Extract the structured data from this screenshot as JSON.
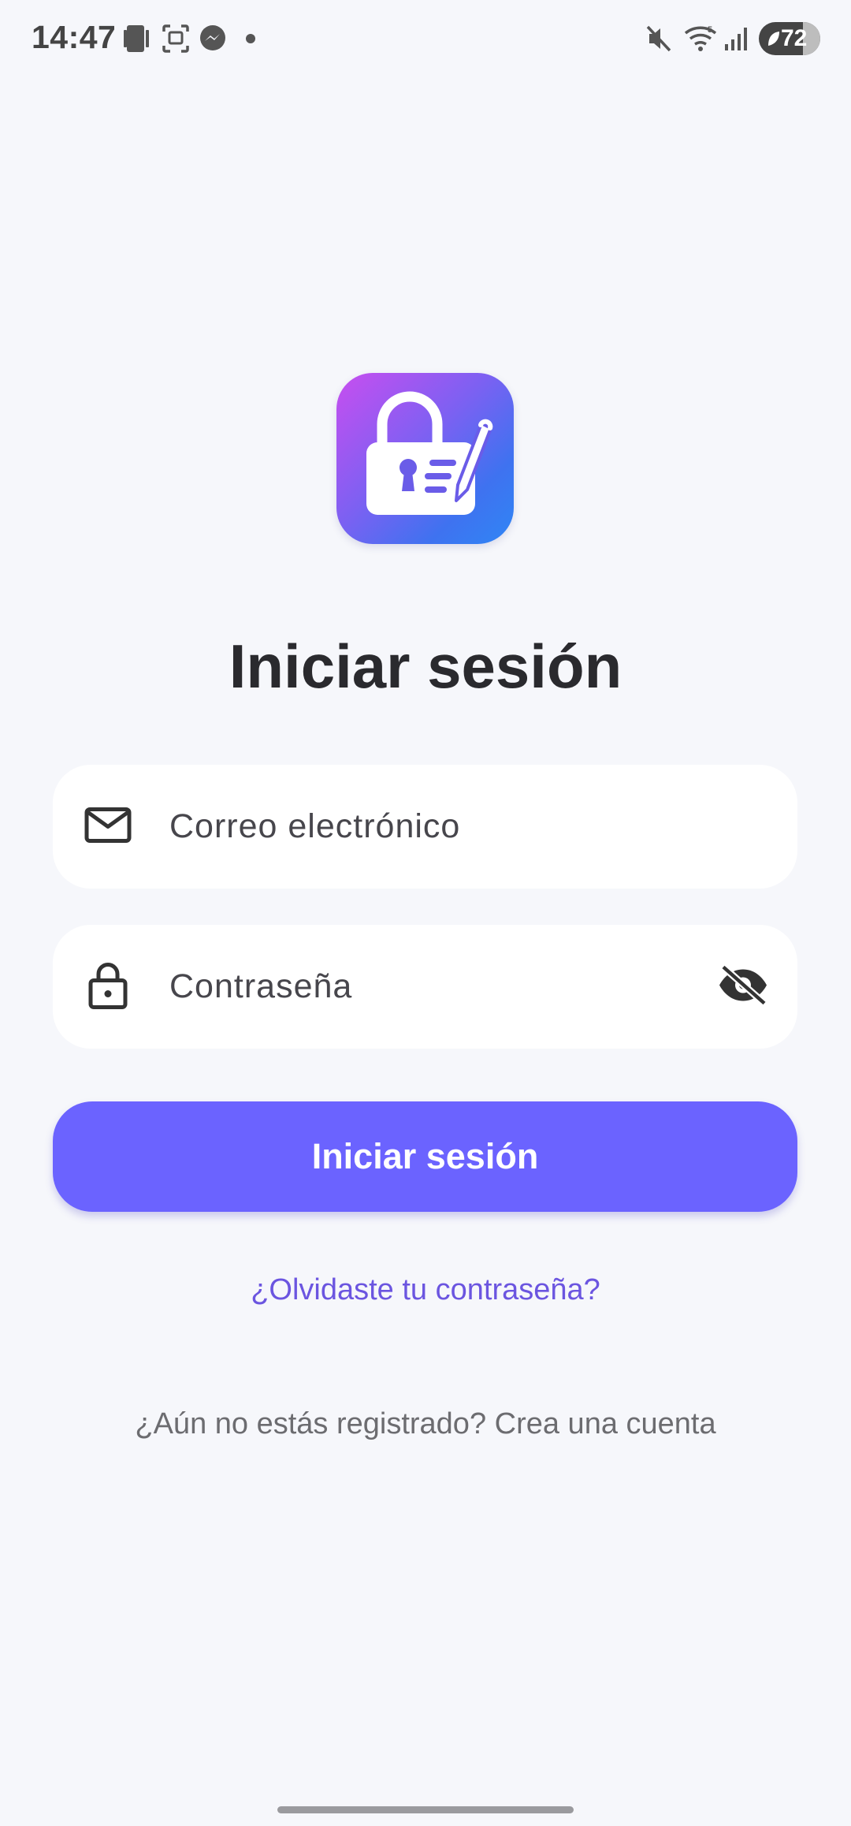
{
  "status_bar": {
    "time": "14:47",
    "battery": "72",
    "icons": [
      "device-icon",
      "screenshot-icon",
      "messenger-icon",
      "notification-dot",
      "mute-icon",
      "wifi-icon",
      "signal-icon",
      "battery-icon"
    ]
  },
  "logo": {
    "icon": "lock-document-pen-icon"
  },
  "page": {
    "title": "Iniciar sesión"
  },
  "form": {
    "email": {
      "placeholder": "Correo electrónico",
      "value": "",
      "icon": "mail-icon"
    },
    "password": {
      "placeholder": "Contraseña",
      "value": "",
      "icon": "lock-icon",
      "toggle_icon": "eye-off-icon"
    },
    "submit_label": "Iniciar sesión",
    "forgot_label": "¿Olvidaste tu contraseña?",
    "register_label": "¿Aún no estás registrado? Crea una cuenta"
  },
  "colors": {
    "background": "#f6f7fb",
    "primary": "#6b63ff",
    "link": "#6b55e0",
    "field": "#ffffff"
  }
}
